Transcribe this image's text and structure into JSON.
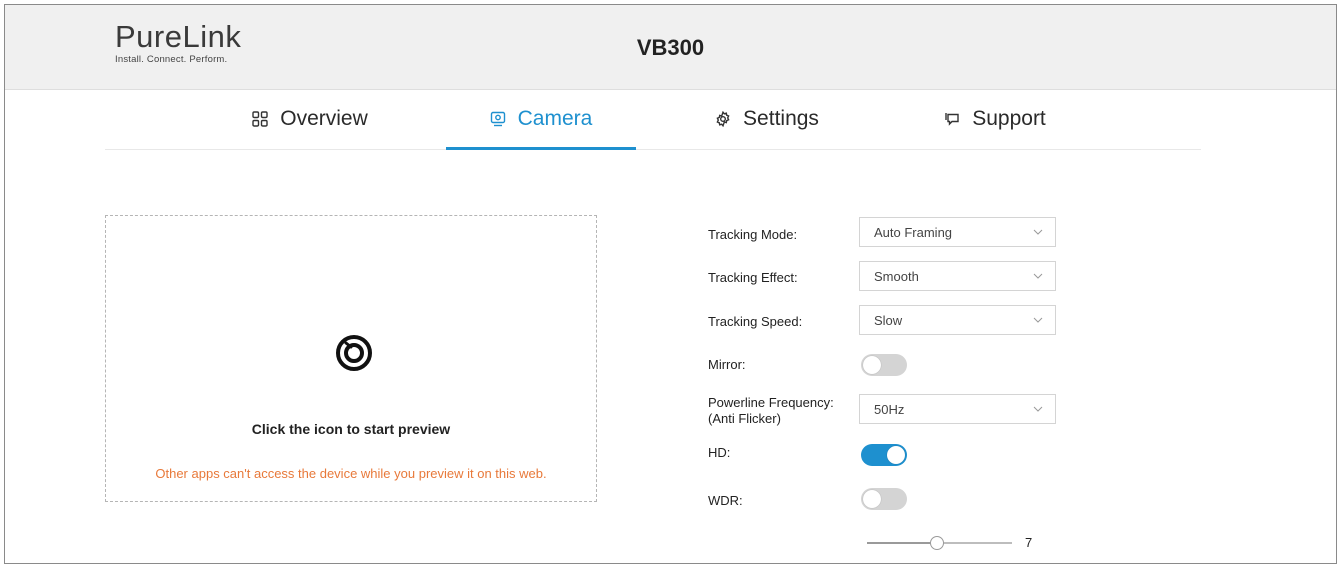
{
  "header": {
    "logo_name": "PureLink",
    "logo_tagline": "Install. Connect. Perform.",
    "device_title": "VB300"
  },
  "tabs": [
    {
      "label": "Overview",
      "icon": "grid-icon",
      "active": false
    },
    {
      "label": "Camera",
      "icon": "camera-icon",
      "active": true
    },
    {
      "label": "Settings",
      "icon": "gear-icon",
      "active": false
    },
    {
      "label": "Support",
      "icon": "chat-icon",
      "active": false
    }
  ],
  "preview": {
    "icon": "record-icon",
    "title": "Click the icon to start preview",
    "warning": "Other apps can't access the device while you preview it on this web."
  },
  "settings": {
    "tracking_mode": {
      "label": "Tracking Mode:",
      "value": "Auto Framing"
    },
    "tracking_effect": {
      "label": "Tracking Effect:",
      "value": "Smooth"
    },
    "tracking_speed": {
      "label": "Tracking Speed:",
      "value": "Slow"
    },
    "mirror": {
      "label": "Mirror:",
      "on": false
    },
    "powerline": {
      "label_line1": "Powerline Frequency:",
      "label_line2": "(Anti Flicker)",
      "value": "50Hz"
    },
    "hd": {
      "label": "HD:",
      "on": true
    },
    "wdr": {
      "label": "WDR:",
      "on": false
    },
    "wdr_level": {
      "value": "7",
      "fraction": 0.48
    }
  },
  "colors": {
    "accent": "#1e90cf",
    "warning": "#e8793a",
    "header_bg": "#f0f0f0"
  }
}
